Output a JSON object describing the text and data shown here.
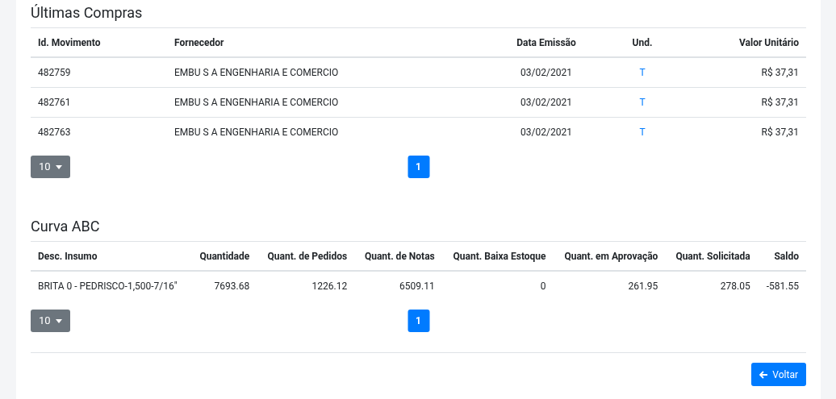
{
  "sections": [
    {
      "title": "Últimas Compras",
      "columns": [
        {
          "label": "Id. Movimento",
          "kind": "text"
        },
        {
          "label": "Fornecedor",
          "kind": "text"
        },
        {
          "label": "Data Emissão",
          "kind": "text"
        },
        {
          "label": "Und.",
          "kind": "link"
        },
        {
          "label": "Valor Unitário",
          "kind": "text"
        }
      ],
      "rows": [
        [
          "482759",
          "EMBU S A ENGENHARIA E COMERCIO",
          "03/02/2021",
          "T",
          "R$ 37,31"
        ],
        [
          "482761",
          "EMBU S A ENGENHARIA E COMERCIO",
          "03/02/2021",
          "T",
          "R$ 37,31"
        ],
        [
          "482763",
          "EMBU S A ENGENHARIA E COMERCIO",
          "03/02/2021",
          "T",
          "R$ 37,31"
        ]
      ],
      "page_size": "10",
      "pages": [
        {
          "label": "1",
          "selected": true
        }
      ]
    },
    {
      "title": "Curva ABC",
      "columns": [
        {
          "label": "Desc. Insumo",
          "kind": "text"
        },
        {
          "label": "Quantidade",
          "kind": "text"
        },
        {
          "label": "Quant. de Pedidos",
          "kind": "text"
        },
        {
          "label": "Quant. de Notas",
          "kind": "text"
        },
        {
          "label": "Quant. Baixa Estoque",
          "kind": "text"
        },
        {
          "label": "Quant. em Aprovação",
          "kind": "text"
        },
        {
          "label": "Quant. Solicitada",
          "kind": "text"
        },
        {
          "label": "Saldo",
          "kind": "text"
        }
      ],
      "rows": [
        [
          "BRITA 0 - PEDRISCO-1,500-7/16\"",
          "7693.68",
          "1226.12",
          "6509.11",
          "0",
          "261.95",
          "278.05",
          "-581.55"
        ]
      ],
      "page_size": "10",
      "pages": [
        {
          "label": "1",
          "selected": true
        }
      ]
    }
  ],
  "back_button": "Voltar"
}
